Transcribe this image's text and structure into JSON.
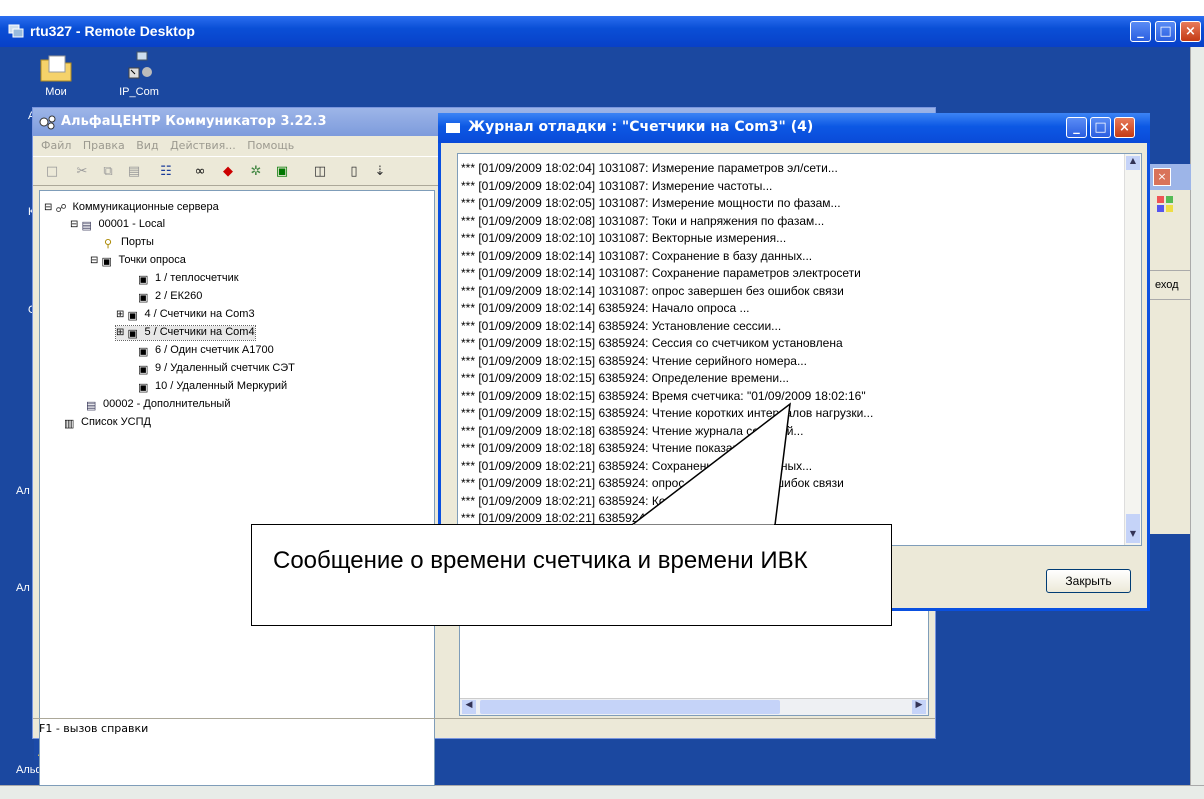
{
  "remote_desktop": {
    "title": "rtu327 - Remote Desktop"
  },
  "desktop": {
    "icons": [
      {
        "label": "Мои",
        "icon": "my-documents-icon"
      },
      {
        "label": "IP_Com",
        "icon": "network-shortcut-icon"
      },
      {
        "label": "АльфаЦЕНТР",
        "icon": "alphacenter-shortcut-icon"
      }
    ],
    "side_chars": [
      "А",
      "К",
      "О",
      "Ал",
      "Ал"
    ]
  },
  "alpha_center": {
    "title": "АльфаЦЕНТР Коммуникатор 3.22.3",
    "menu": [
      "Файл",
      "Правка",
      "Вид",
      "Действия...",
      "Помощь"
    ],
    "toolbar": [
      "new-icon",
      "cut-icon",
      "copy-icon",
      "paste-icon",
      "tree-icon",
      "binoculars-icon",
      "diamond-icon",
      "gears-icon",
      "monitor-icon",
      "chart-icon",
      "device-icon",
      "tool-icon"
    ],
    "tree": [
      {
        "label": "Коммуникационные сервера",
        "icon": "server-group-icon"
      },
      {
        "label": "00001 - Local",
        "icon": "computer-icon"
      },
      {
        "label": "Порты",
        "icon": "ports-icon"
      },
      {
        "label": "Точки опроса",
        "icon": "meter-icon"
      },
      {
        "label": "1 / теплосчетчик",
        "icon": "meter-icon"
      },
      {
        "label": "2 / ЕК260",
        "icon": "meter-icon"
      },
      {
        "label": "4 / Счетчики на Com3",
        "icon": "meter-icon"
      },
      {
        "label": "5 / Счетчики на Com4",
        "icon": "meter-icon"
      },
      {
        "label": "6 / Один счетчик А1700",
        "icon": "meter-icon"
      },
      {
        "label": "9 / Удаленный счетчик СЭТ",
        "icon": "meter-icon"
      },
      {
        "label": "10 / Удаленный Меркурий",
        "icon": "meter-icon"
      },
      {
        "label": "00002 - Дополнительный",
        "icon": "computer-icon"
      },
      {
        "label": "Список УСПД",
        "icon": "list-icon"
      }
    ],
    "status": "F1 - вызов справки"
  },
  "debug_log": {
    "title": "Журнал отладки : \"Счетчики на Com3\"  (4)",
    "lines": [
      "*** [01/09/2009 18:02:04]  1031087: Измерение параметров эл/сети...",
      "*** [01/09/2009 18:02:04]  1031087: Измерение частоты...",
      "*** [01/09/2009 18:02:05]  1031087: Измерение мощности по фазам...",
      "*** [01/09/2009 18:02:08]  1031087: Токи и напряжения по фазам...",
      "*** [01/09/2009 18:02:10]  1031087: Векторные измерения...",
      "*** [01/09/2009 18:02:14]  1031087: Сохранение в базу данных...",
      "*** [01/09/2009 18:02:14]  1031087: Сохранение параметров электросети",
      "*** [01/09/2009 18:02:14]  1031087: опрос завершен без ошибок связи",
      "*** [01/09/2009 18:02:14]  6385924: Начало опроса ...",
      "*** [01/09/2009 18:02:14]  6385924: Установление сессии...",
      "*** [01/09/2009 18:02:15]  6385924: Сессия со счетчиком установлена",
      "*** [01/09/2009 18:02:15]  6385924: Чтение серийного номера...",
      "*** [01/09/2009 18:02:15]  6385924: Определение времени...",
      "*** [01/09/2009 18:02:15]  6385924: Время счетчика: \"01/09/2009 18:02:16\"",
      "*** [01/09/2009 18:02:15]  6385924: Чтение коротких интервалов нагрузки...",
      "*** [01/09/2009 18:02:18]  6385924: Чтение журнала событий...",
      "*** [01/09/2009 18:02:18]  6385924: Чтение показаний...",
      "*** [01/09/2009 18:02:21]  6385924: Сохранение в базу данных...",
      "*** [01/09/2009 18:02:21]  6385924: опрос завершен без ошибок связи",
      "*** [01/09/2009 18:02:21]  6385924: Конец опроса ...",
      "*** [01/09/2009 18:02:21]  6385924: Закрытие сессии..."
    ],
    "close_button": "Закрыть"
  },
  "hidden_window": {
    "partial_label": "еход"
  },
  "callout": {
    "text": "Сообщение о времени счетчика и времени ИВК"
  }
}
